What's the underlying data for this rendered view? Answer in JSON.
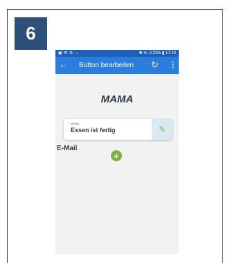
{
  "step": {
    "number": "6"
  },
  "status_bar": {
    "left_icons": "▣ ✉ ⊜ …",
    "right_text": "✱ ≋ .ıl 31% ▮ 17:10"
  },
  "app_bar": {
    "back_icon": "←",
    "title": "Button bearbeiten",
    "refresh_icon": "↻",
    "more_icon": "⋮"
  },
  "content": {
    "heading": "MAMA",
    "card": {
      "small_label": "MAMA",
      "main_label": "Essen ist fertig",
      "edit_icon": "✎"
    },
    "section_label": "E-Mail",
    "add_icon": "+"
  },
  "colors": {
    "badge": "#2e4f7a",
    "app_bar": "#2b7de0",
    "status_bar": "#1f5fb5",
    "accent_green": "#7cb342"
  }
}
